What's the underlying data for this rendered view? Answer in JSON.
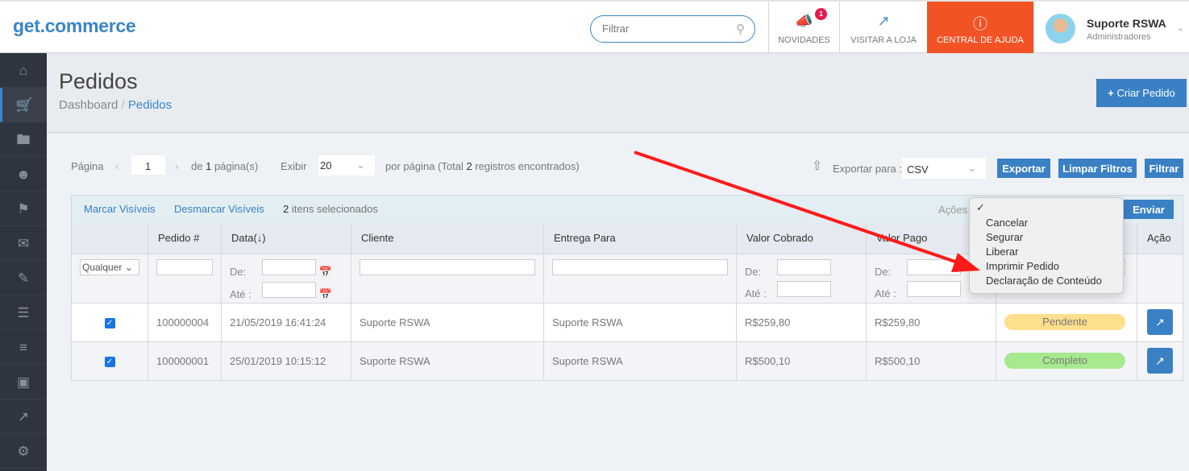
{
  "brand": "get.commerce",
  "search": {
    "placeholder": "Filtrar"
  },
  "nav": {
    "novidades": "NOVIDADES",
    "novidades_badge": "1",
    "visitar": "VISITAR A LOJA",
    "ajuda": "CENTRAL DE AJUDA"
  },
  "user": {
    "name": "Suporte RSWA",
    "role": "Administradores"
  },
  "sidebar": [
    "home-icon",
    "cart-icon",
    "folder-icon",
    "user-icon",
    "bookmark-icon",
    "mail-icon",
    "edit-icon",
    "list-icon",
    "menu-icon",
    "image-icon",
    "chart-icon",
    "gear-icon"
  ],
  "page": {
    "title": "Pedidos",
    "crumb_root": "Dashboard",
    "crumb_sep": " / ",
    "crumb_current": "Pedidos",
    "create_label": "Criar Pedido"
  },
  "pager": {
    "page_label": "Página",
    "page_value": "1",
    "of_label": "de",
    "total_pages": "1",
    "pages_suffix": "página(s)",
    "show_label": "Exibir",
    "per_page": "20",
    "per_page_label": "por página (Total",
    "total_records": "2",
    "records_suffix": "registros encontrados)"
  },
  "export": {
    "label": "Exportar para :",
    "format": "CSV",
    "export_btn": "Exportar",
    "clear_btn": "Limpar Filtros",
    "filter_btn": "Filtrar"
  },
  "mass": {
    "mark": "Marcar Visíveis",
    "unmark": "Desmarcar Visíveis",
    "count": "2",
    "count_suffix": "itens selecionados",
    "actions_label": "Ações",
    "submit": "Enviar"
  },
  "dropdown": {
    "selected": "✓",
    "options": [
      "Cancelar",
      "Segurar",
      "Liberar",
      "Imprimir Pedido",
      "Declaração de Conteúdo"
    ]
  },
  "columns": [
    "",
    "Pedido #",
    "Data",
    "Cliente",
    "Entrega Para",
    "Valor Cobrado",
    "Valor Pago",
    "",
    "Ação"
  ],
  "sort_indicator": "(↓)",
  "filters": {
    "any": "Qualquer",
    "from": "De:",
    "to": "Até :"
  },
  "rows": [
    {
      "checked": true,
      "id": "100000004",
      "date": "21/05/2019 16:41:24",
      "client": "Suporte RSWA",
      "ship": "Suporte RSWA",
      "charged": "R$259,80",
      "paid": "R$259,80",
      "status": "Pendente",
      "status_color": "#fedf8c"
    },
    {
      "checked": true,
      "id": "100000001",
      "date": "25/01/2019 10:15:12",
      "client": "Suporte RSWA",
      "ship": "Suporte RSWA",
      "charged": "R$500,10",
      "paid": "R$500,10",
      "status": "Completo",
      "status_color": "#a6e98f"
    }
  ],
  "colors": {
    "accent": "#3a80c5",
    "help": "#f25325",
    "sidebar": "#2f3540",
    "arrow": "#ff1a1a"
  }
}
